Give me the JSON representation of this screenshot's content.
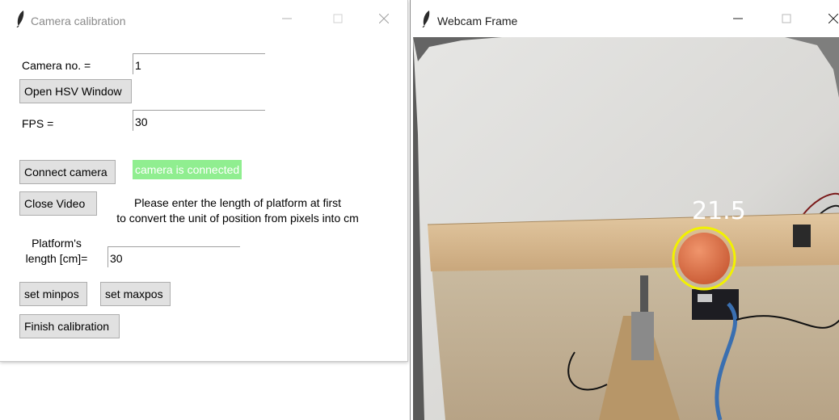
{
  "calib_window": {
    "title": "Camera calibration",
    "camera_no_label": "Camera no. =",
    "camera_no_value": "1",
    "open_hsv_button": "Open HSV Window",
    "fps_label": "FPS =",
    "fps_value": "30",
    "connect_button": "Connect camera",
    "status_text": "camera is connected",
    "close_video_button": "Close Video",
    "instruction_line1": "Please enter the length of platform at first",
    "instruction_line2": "to convert the unit of position from pixels into cm",
    "platform_label_line1": "Platform's",
    "platform_label_line2": "length [cm]=",
    "platform_value": "30",
    "set_minpos_button": "set minpos",
    "set_maxpos_button": "set maxpos",
    "finish_button": "Finish calibration"
  },
  "webcam_window": {
    "title": "Webcam Frame",
    "overlay_value": "21.5",
    "tracker_color": "#f2f200",
    "ball_color": "#e2734a"
  },
  "window_controls": {
    "minimize_icon": "minimize-icon",
    "maximize_icon": "maximize-icon",
    "close_icon": "close-icon"
  }
}
